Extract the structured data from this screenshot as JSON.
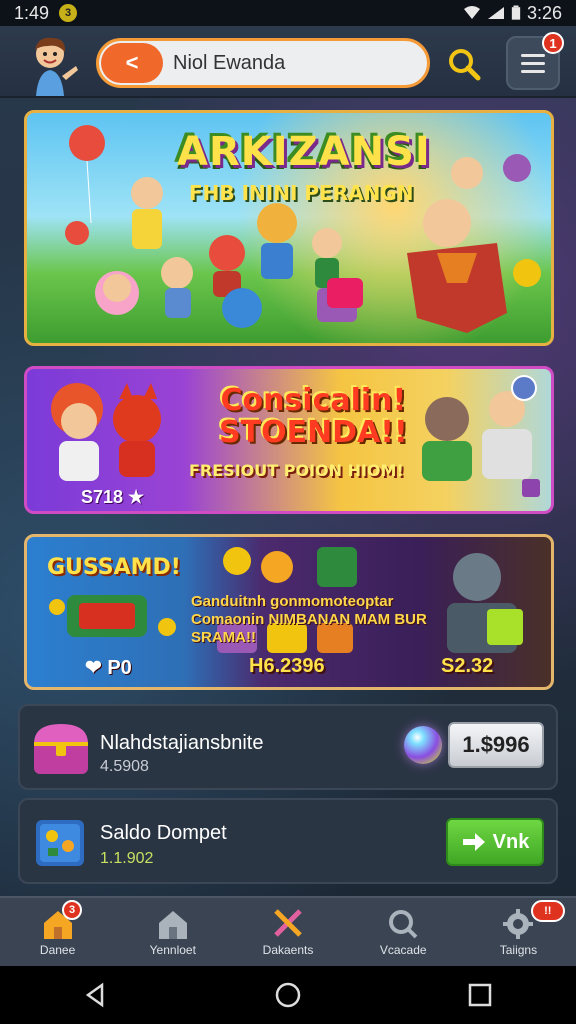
{
  "status_bar": {
    "time_left": "1:49",
    "notif_badge": "3",
    "time_right": "3:26"
  },
  "top_bar": {
    "search_text": "Niol Ewanda",
    "back_label": "<",
    "menu_badge": "1"
  },
  "banners": {
    "banner1": {
      "title": "ARKIZANSI",
      "subtitle": "FHB ININI PERANGN"
    },
    "banner2": {
      "title_line1": "Consicalin!",
      "title_line2": "STOENDA!!",
      "subtitle": "FRESIOUT POION HIOM!",
      "price": "S718 ★"
    },
    "banner3": {
      "title": "GUSSAMD!",
      "subtitle": "Ganduitnh gonmomoteoptar Comaonin NIMBANAN MAM BUR SRAMA!!",
      "left_price": "❤ P0",
      "mid_price": "H6.2396",
      "right_price": "S2.32"
    }
  },
  "cards": [
    {
      "title": "Nlahdstajiansbnite",
      "subtitle": "4.5908",
      "price": "1.$996"
    },
    {
      "title": "Saldo Dompet",
      "subtitle": "1.1.902",
      "button": "Vnk"
    }
  ],
  "bottom_nav": [
    {
      "label": "Danee",
      "icon": "home-icon",
      "badge": "3"
    },
    {
      "label": "Yennloet",
      "icon": "shop-icon"
    },
    {
      "label": "Dakaents",
      "icon": "sword-icon"
    },
    {
      "label": "Vcacade",
      "icon": "search-icon"
    },
    {
      "label": "Taiigns",
      "icon": "gear-icon",
      "badge": "!!"
    }
  ],
  "colors": {
    "accent_orange": "#f0692a",
    "accent_green": "#4fbf30",
    "badge_red": "#e0331f"
  }
}
